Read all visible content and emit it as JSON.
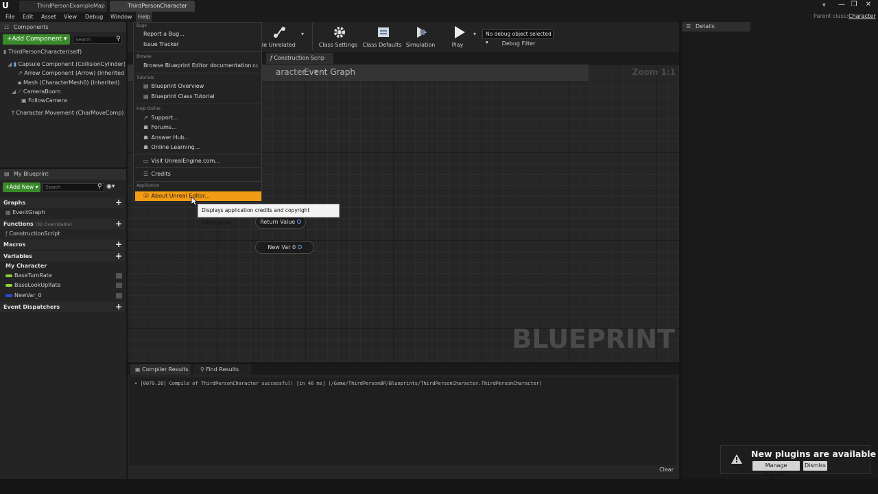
{
  "window": {
    "tabs": [
      "ThirdPersonExampleMap",
      "ThirdPersonCharacter"
    ],
    "parent_class_label": "Parent class:",
    "parent_class_value": "Character",
    "controls": [
      "—",
      "❐",
      "✕"
    ]
  },
  "menubar": [
    "File",
    "Edit",
    "Asset",
    "View",
    "Debug",
    "Window",
    "Help"
  ],
  "components": {
    "title": "Components",
    "add_button": "+Add Component ▾",
    "search_placeholder": "Search",
    "self_item": "ThirdPersonCharacter(self)",
    "items": [
      "Capsule Component (CollisionCylinder) (Inherited)",
      "Arrow Component (Arrow) (Inherited)",
      "Mesh (CharacterMesh0) (Inherited)",
      "CameraBoom",
      "FollowCamera",
      "Character Movement (CharMoveComp) (Inherited)"
    ]
  },
  "my_blueprint": {
    "title": "My Blueprint",
    "add_button": "+Add New ▾",
    "search_placeholder": "Search",
    "graphs_label": "Graphs",
    "event_graph": "EventGraph",
    "functions_label": "Functions",
    "functions_count": "(32 Overridable)",
    "construction_script": "ConstructionScript",
    "macros_label": "Macros",
    "variables_label": "Variables",
    "category": "My Character",
    "variables": [
      {
        "name": "BaseTurnRate",
        "color": "#8ad33a"
      },
      {
        "name": "BaseLookUpRate",
        "color": "#8ad33a"
      },
      {
        "name": "NewVar_0",
        "color": "#2a4fd6"
      }
    ],
    "dispatchers_label": "Event Dispatchers"
  },
  "toolbar": {
    "hide_unrelated": "de Unrelated",
    "class_settings": "Class Settings",
    "class_defaults": "Class Defaults",
    "simulation": "Simulation",
    "play": "Play",
    "debug_select": "No debug object selected ▾",
    "debug_filter": "Debug Filter"
  },
  "graph": {
    "tab_construction": "Construction Scrip",
    "breadcrumb_parent": "aracter",
    "breadcrumb_current": "Event Graph",
    "zoom": "Zoom 1:1",
    "watermark": "BLUEPRINT",
    "node_return": "Return Value",
    "node_var": "New Var 0"
  },
  "help_menu": {
    "sections": [
      {
        "header": "Bugs",
        "items": [
          {
            "label": "Report a Bug...",
            "icon": ""
          },
          {
            "label": "Issue Tracker",
            "icon": ""
          }
        ]
      },
      {
        "header": "Browse",
        "items": [
          {
            "label": "Browse Blueprint Editor documentation...",
            "icon": "",
            "shortcut": "F1"
          }
        ]
      },
      {
        "header": "Tutorials",
        "items": [
          {
            "label": "Blueprint Overview",
            "icon": "book-icon"
          },
          {
            "label": "Blueprint Class Tutorial",
            "icon": "book-icon"
          }
        ]
      },
      {
        "header": "Help Online",
        "items": [
          {
            "label": "Support...",
            "icon": "external-link-icon"
          },
          {
            "label": "Forums...",
            "icon": "forums-icon"
          },
          {
            "label": "Answer Hub...",
            "icon": "answerhub-icon"
          },
          {
            "label": "Online Learning...",
            "icon": "learning-icon"
          },
          {
            "label": "Visit UnrealEngine.com...",
            "icon": "web-icon"
          },
          {
            "label": "Credits",
            "icon": "credits-icon"
          }
        ]
      },
      {
        "header": "Application",
        "items": [
          {
            "label": "About Unreal Editor...",
            "icon": "unreal-logo-icon"
          }
        ]
      }
    ],
    "tooltip": "Displays application credits and copyright information"
  },
  "details": {
    "title": "Details"
  },
  "bottom": {
    "tabs": [
      "Compiler Results",
      "Find Results"
    ],
    "log": "[0079.26] Compile of ThirdPersonCharacter successful! [in 46 ms] (/Game/ThirdPersonBP/Blueprints/ThirdPersonCharacter.ThirdPersonCharacter)",
    "clear": "Clear"
  },
  "notification": {
    "title": "New plugins are available",
    "manage": "Manage Plugins...",
    "dismiss": "Dismiss"
  },
  "colors": {
    "accent": "#f39b14",
    "add_green": "#3a8a2b"
  }
}
